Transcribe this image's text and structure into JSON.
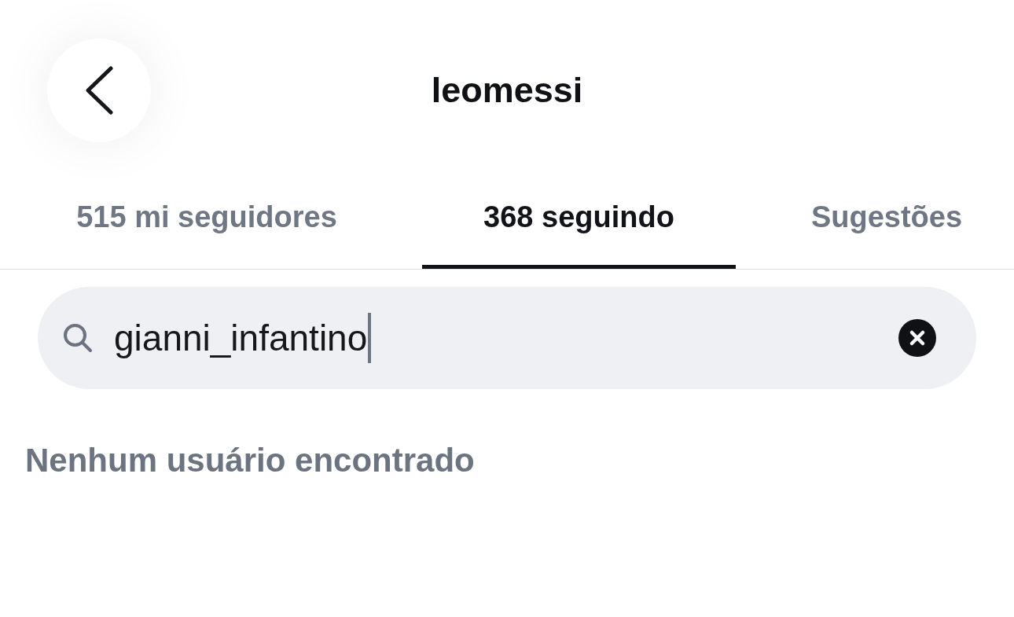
{
  "header": {
    "title": "leomessi"
  },
  "tabs": [
    {
      "label": "515 mi seguidores",
      "selected": false
    },
    {
      "label": "368 seguindo",
      "selected": true
    },
    {
      "label": "Sugestões",
      "selected": false
    }
  ],
  "search": {
    "value": "gianni_infantino"
  },
  "empty_message": "Nenhum usuário encontrado"
}
